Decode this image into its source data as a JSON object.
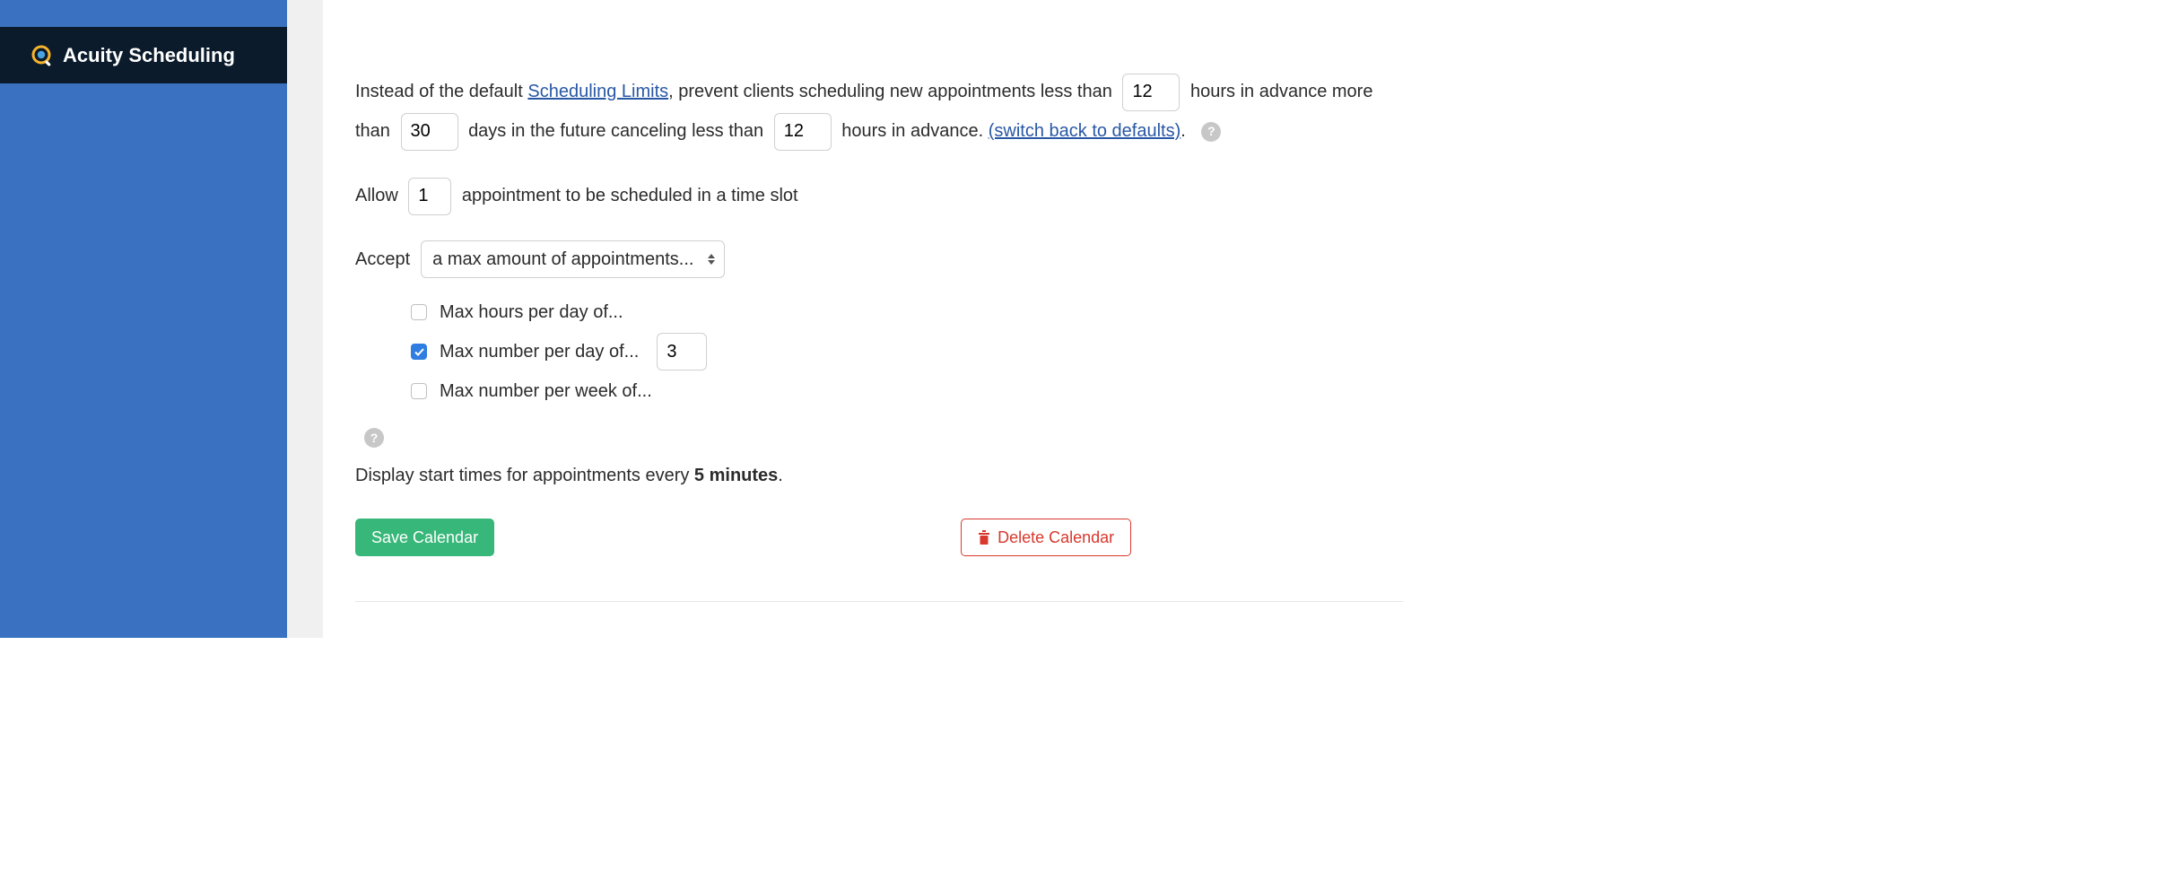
{
  "brand": {
    "name": "Acuity Scheduling"
  },
  "limits": {
    "prefix": "Instead of the default ",
    "link_text": "Scheduling Limits",
    "text1": ", prevent clients scheduling new appointments less than",
    "hours_advance": "12",
    "text2": "hours in advance more than",
    "days_future": "30",
    "text3": "days in the future canceling less than",
    "cancel_hours": "12",
    "text4": "hours in advance.",
    "switch_link": "(switch back to defaults)",
    "period": "."
  },
  "allow": {
    "prefix": "Allow",
    "value": "1",
    "suffix": "appointment to be scheduled in a time slot"
  },
  "accept": {
    "label": "Accept",
    "selected": "a max amount of appointments...",
    "options": [
      {
        "label": "Max hours per day of...",
        "checked": false,
        "value": ""
      },
      {
        "label": "Max number per day of...",
        "checked": true,
        "value": "3"
      },
      {
        "label": "Max number per week of...",
        "checked": false,
        "value": ""
      }
    ]
  },
  "display": {
    "prefix": "Display start times for appointments every ",
    "value": "5 minutes",
    "suffix": "."
  },
  "buttons": {
    "save": "Save Calendar",
    "delete": "Delete Calendar"
  }
}
